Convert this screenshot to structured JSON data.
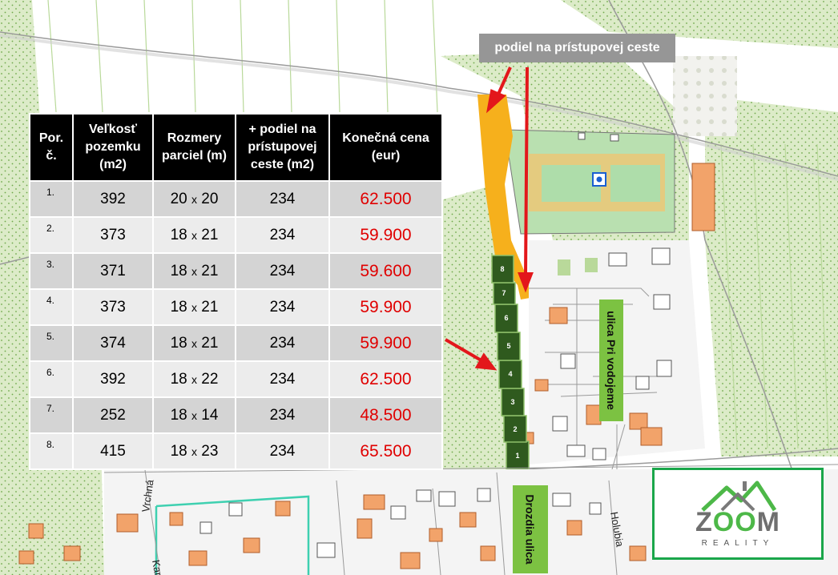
{
  "callout": "podiel na prístupovej ceste",
  "table": {
    "headers": [
      "Por. č.",
      "Veľkosť pozemku (m2)",
      "Rozmery parciel (m)",
      "+ podiel na prístupovej ceste (m2)",
      "Konečná cena (eur)"
    ],
    "rows": [
      {
        "no": "1.",
        "size": "392",
        "w": "20",
        "h": "20",
        "access": "234",
        "price": "62.500"
      },
      {
        "no": "2.",
        "size": "373",
        "w": "18",
        "h": "21",
        "access": "234",
        "price": "59.900"
      },
      {
        "no": "3.",
        "size": "371",
        "w": "18",
        "h": "21",
        "access": "234",
        "price": "59.600"
      },
      {
        "no": "4.",
        "size": "373",
        "w": "18",
        "h": "21",
        "access": "234",
        "price": "59.900"
      },
      {
        "no": "5.",
        "size": "374",
        "w": "18",
        "h": "21",
        "access": "234",
        "price": "59.900"
      },
      {
        "no": "6.",
        "size": "392",
        "w": "18",
        "h": "22",
        "access": "234",
        "price": "62.500"
      },
      {
        "no": "7.",
        "size": "252",
        "w": "18",
        "h": "14",
        "access": "234",
        "price": "48.500"
      },
      {
        "no": "8.",
        "size": "415",
        "w": "18",
        "h": "23",
        "access": "234",
        "price": "65.500"
      }
    ]
  },
  "dim_sep": "x",
  "plot_labels": [
    "1",
    "2",
    "3",
    "4",
    "5",
    "6",
    "7",
    "8"
  ],
  "streets": {
    "pri_vodojeme": "ulica Pri vodojeme",
    "drozdia": "Drozdia ulica",
    "vrchna": "Vrchná",
    "kamen": "Kamen",
    "holubia": "Holubia"
  },
  "logo": {
    "word_a": "Z",
    "word_b": "OO",
    "word_c": "M",
    "sub": "REALITY"
  },
  "colors": {
    "plot_fill": "#2f5a1e",
    "access_road": "#f6b01c",
    "price": "#e00000",
    "street_label_bg": "#7cc242",
    "logo_border": "#1aa64a"
  }
}
